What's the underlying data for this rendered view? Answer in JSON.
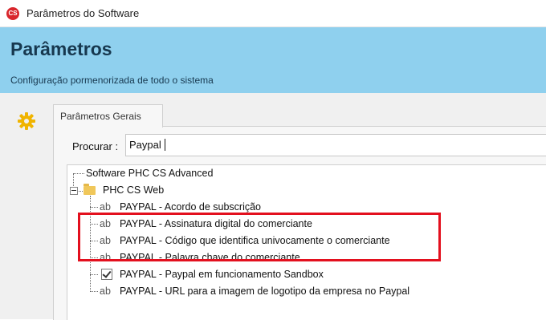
{
  "window": {
    "title": "Parâmetros do Software",
    "logo_text": "CS"
  },
  "header": {
    "title": "Parâmetros",
    "subtitle": "Configuração pormenorizada de todo o sistema"
  },
  "tabs": [
    {
      "label": "Parâmetros Gerais"
    }
  ],
  "search": {
    "label": "Procurar :",
    "value": "Paypal"
  },
  "tree": {
    "root": "Software PHC CS Advanced",
    "folder": "PHC CS Web",
    "items": [
      {
        "icon": "ab",
        "label": "PAYPAL - Acordo de subscrição"
      },
      {
        "icon": "ab",
        "label": "PAYPAL - Assinatura digital do comerciante"
      },
      {
        "icon": "ab",
        "label": "PAYPAL - Código que identifica univocamente o comerciante"
      },
      {
        "icon": "ab",
        "label": "PAYPAL - Palavra chave do comerciante"
      },
      {
        "icon": "checkbox",
        "label": "PAYPAL - Paypal em funcionamento Sandbox"
      },
      {
        "icon": "ab",
        "label": "PAYPAL - URL para a imagem de logotipo da empresa no Paypal"
      }
    ]
  },
  "colors": {
    "header_bg": "#8fd0ee",
    "highlight": "#e3101e",
    "gear": "#f0b400"
  }
}
